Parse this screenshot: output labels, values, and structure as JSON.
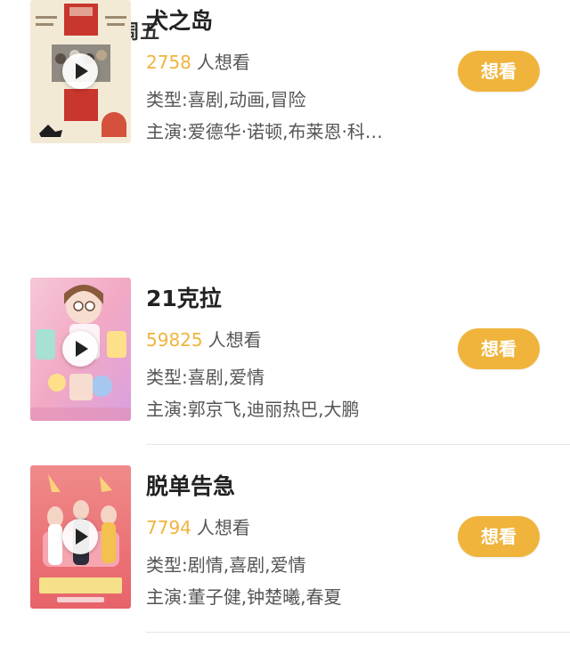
{
  "header": {
    "date": "4月20日 周五"
  },
  "movies": [
    {
      "title": "21克拉",
      "want_count": "59825",
      "want_suffix": "人想看",
      "type_text": "类型:喜剧,爱情",
      "cast_text": "主演:郭京飞,迪丽热巴,大鹏",
      "button_label": "想看",
      "poster_theme": "pink-pastel-comedy"
    },
    {
      "title": "脱单告急",
      "want_count": "7794",
      "want_suffix": "人想看",
      "type_text": "类型:剧情,喜剧,爱情",
      "cast_text": "主演:董子健,钟楚曦,春夏",
      "button_label": "想看",
      "poster_theme": "coral-pink-romance"
    },
    {
      "title": "犬之岛",
      "want_count": "2758",
      "want_suffix": "人想看",
      "type_text": "类型:喜剧,动画,冒险",
      "cast_text": "主演:爱德华·诺顿,布莱恩·科…",
      "button_label": "想看",
      "poster_theme": "cream-red-animation"
    }
  ],
  "colors": {
    "accent": "#f0b43c",
    "title": "#222222",
    "text": "#555555",
    "divider": "#e6e6e6"
  }
}
